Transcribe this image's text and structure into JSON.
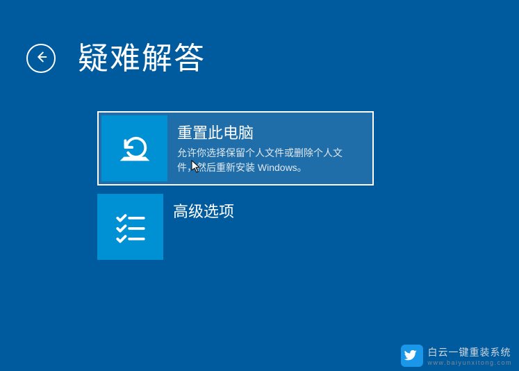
{
  "header": {
    "title": "疑难解答"
  },
  "options": [
    {
      "title": "重置此电脑",
      "desc": "允许你选择保留个人文件或删除个人文件，然后重新安装 Windows。"
    },
    {
      "title": "高级选项",
      "desc": ""
    }
  ],
  "watermark": {
    "title": "白云一键重装系统",
    "url": "www.baiyunxitong.com"
  }
}
